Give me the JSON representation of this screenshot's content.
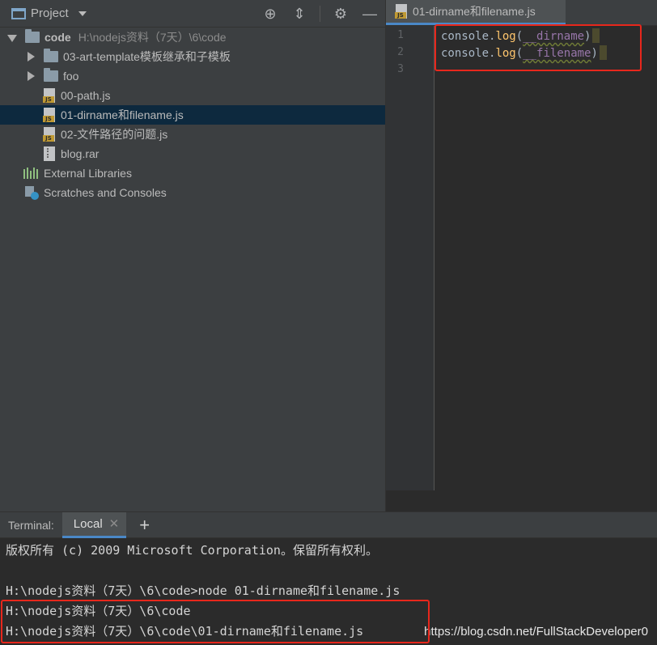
{
  "project_panel": {
    "title": "Project",
    "header_icons": [
      "target-icon",
      "collapse-icon",
      "gear-icon",
      "minimize-icon"
    ],
    "tree": {
      "root": {
        "name": "code",
        "path": "H:\\nodejs资料（7天）\\6\\code"
      },
      "items": [
        {
          "label": "03-art-template模板继承和子模板",
          "type": "folder"
        },
        {
          "label": "foo",
          "type": "folder"
        },
        {
          "label": "00-path.js",
          "type": "js"
        },
        {
          "label": "01-dirname和filename.js",
          "type": "js",
          "selected": true
        },
        {
          "label": "02-文件路径的问题.js",
          "type": "js"
        },
        {
          "label": "blog.rar",
          "type": "rar"
        }
      ],
      "extras": [
        {
          "label": "External Libraries"
        },
        {
          "label": "Scratches and Consoles"
        }
      ]
    }
  },
  "editor": {
    "tab_label": "01-dirname和filename.js",
    "line_numbers": [
      "1",
      "2",
      "3"
    ],
    "lines": [
      {
        "obj": "console",
        "dot": ".",
        "fn": "log",
        "open": "(",
        "arg": "__dirname",
        "close": ")"
      },
      {
        "obj": "console",
        "dot": ".",
        "fn": "log",
        "open": "(",
        "arg": "__filename",
        "close": ")"
      }
    ]
  },
  "terminal": {
    "title": "Terminal:",
    "tab_label": "Local",
    "lines": [
      "版权所有 (c) 2009 Microsoft Corporation。保留所有权利。",
      "",
      "H:\\nodejs资料（7天）\\6\\code>node 01-dirname和filename.js",
      "H:\\nodejs资料（7天）\\6\\code",
      "H:\\nodejs资料（7天）\\6\\code\\01-dirname和filename.js"
    ]
  },
  "watermark": "https://blog.csdn.net/FullStackDeveloper0",
  "colors": {
    "highlight": "#e8271c",
    "selection": "#0d293e",
    "function": "#ffc66d",
    "global": "#9876aa"
  }
}
